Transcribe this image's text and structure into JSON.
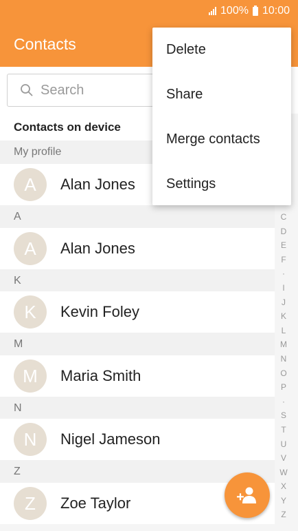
{
  "status": {
    "signal_icon": "signal-icon",
    "battery": "100%",
    "battery_icon": "battery-icon",
    "time": "10:00"
  },
  "appbar": {
    "title": "Contacts"
  },
  "search": {
    "placeholder": "Search",
    "icon": "search-icon"
  },
  "list": {
    "section_title": "Contacts on device",
    "profile_header": "My profile",
    "profile": {
      "initial": "A",
      "name": "Alan Jones"
    },
    "groups": [
      {
        "letter": "A",
        "contacts": [
          {
            "initial": "A",
            "name": "Alan Jones"
          }
        ]
      },
      {
        "letter": "K",
        "contacts": [
          {
            "initial": "K",
            "name": "Kevin Foley"
          }
        ]
      },
      {
        "letter": "M",
        "contacts": [
          {
            "initial": "M",
            "name": "Maria Smith"
          }
        ]
      },
      {
        "letter": "N",
        "contacts": [
          {
            "initial": "N",
            "name": "Nigel Jameson"
          }
        ]
      },
      {
        "letter": "Z",
        "contacts": [
          {
            "initial": "Z",
            "name": "Zoe Taylor"
          }
        ]
      }
    ]
  },
  "index": [
    "C",
    "D",
    "E",
    "F",
    "·",
    "I",
    "J",
    "K",
    "L",
    "M",
    "N",
    "O",
    "P",
    "·",
    "S",
    "T",
    "U",
    "V",
    "W",
    "X",
    "Y",
    "Z"
  ],
  "fab": {
    "icon": "add-contact-icon"
  },
  "menu": {
    "items": [
      "Delete",
      "Share",
      "Merge contacts",
      "Settings"
    ]
  },
  "colors": {
    "accent": "#f7943a",
    "avatar_bg": "#e6ded2"
  }
}
